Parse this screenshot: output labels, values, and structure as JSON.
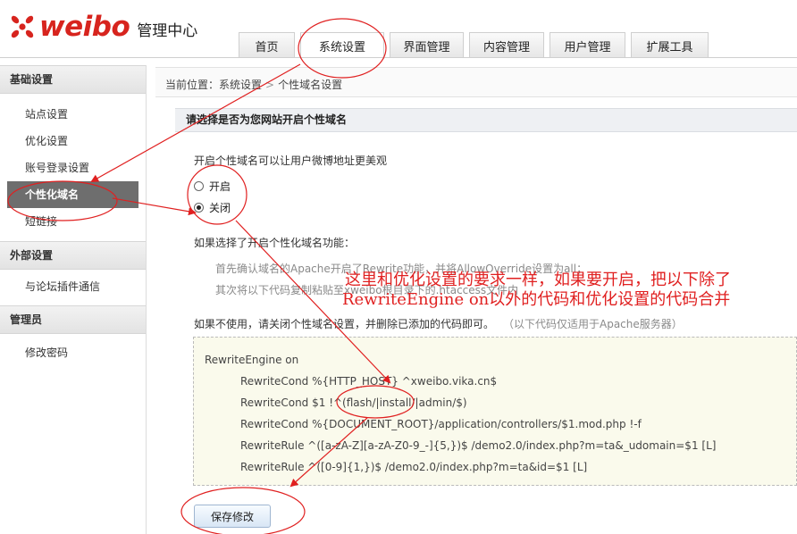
{
  "header": {
    "logo_text": "weibo",
    "logo_subtitle": "管理中心",
    "tabs": [
      {
        "label": "首页"
      },
      {
        "label": "系统设置"
      },
      {
        "label": "界面管理"
      },
      {
        "label": "内容管理"
      },
      {
        "label": "用户管理"
      },
      {
        "label": "扩展工具"
      }
    ],
    "active_tab": "系统设置"
  },
  "sidebar": {
    "sections": [
      {
        "title": "基础设置",
        "items": [
          "站点设置",
          "优化设置",
          "账号登录设置",
          "个性化域名",
          "短链接"
        ]
      },
      {
        "title": "外部设置",
        "items": [
          "与论坛插件通信"
        ]
      },
      {
        "title": "管理员",
        "items": [
          "修改密码"
        ]
      }
    ],
    "active_item": "个性化域名"
  },
  "breadcrumb": {
    "prefix": "当前位置：",
    "level1": "系统设置",
    "separator": ">",
    "level2": "个性域名设置"
  },
  "main": {
    "section_title": "请选择是否为您网站开启个性域名",
    "intro": "开启个性域名可以让用户微博地址更美观",
    "options": [
      {
        "label": "开启",
        "checked": false
      },
      {
        "label": "关闭",
        "checked": true
      }
    ],
    "if_enabled_title": "如果选择了开启个性化域名功能：",
    "step1": "首先确认域名的Apache开启了Rewrite功能，并将AllowOverride设置为all；",
    "step2": "其次将以下代码复制粘贴至xweibo根目录下的.htaccess文件内",
    "disable_note": "如果不使用，请关闭个性域名设置，并删除已添加的代码即可。",
    "apache_note": "（以下代码仅适用于Apache服务器）",
    "code_lines": [
      "RewriteEngine on",
      "RewriteCond %{HTTP_HOST} ^xweibo.vika.cn$",
      "RewriteCond $1 !^(flash/|install/|admin/$)",
      "RewriteCond %{DOCUMENT_ROOT}/application/controllers/$1.mod.php !-f",
      "RewriteRule ^([a-zA-Z][a-zA-Z0-9_-]{5,})$ /demo2.0/index.php?m=ta&_udomain=$1 [L]",
      "RewriteRule ^([0-9]{1,})$ /demo2.0/index.php?m=ta&id=$1 [L]"
    ],
    "save_button": "保存修改"
  },
  "annotation": {
    "line1": "这里和优化设置的要求一样，如果要开启，把以下除了",
    "line2": "RewriteEngine on以外的代码和优化设置的代码合并",
    "color": "#e02020"
  },
  "colors": {
    "brand_red": "#d7241e",
    "active_sidebar": "#6e6e6e",
    "annotation_red": "#e02020"
  }
}
